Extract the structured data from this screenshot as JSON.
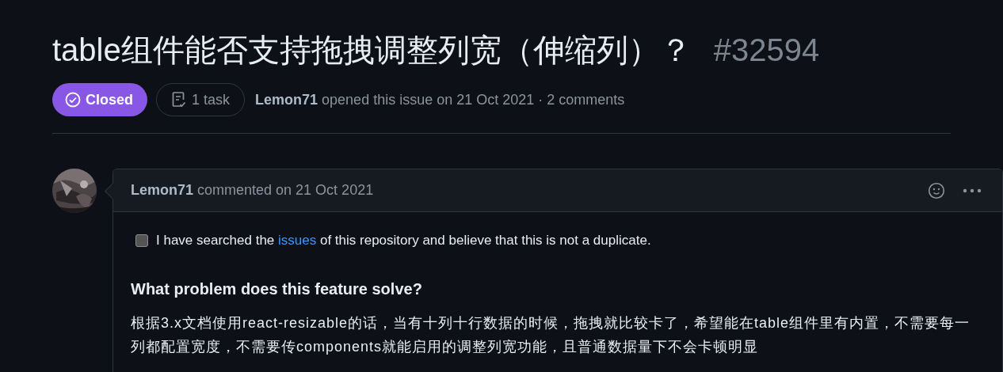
{
  "issue": {
    "title": "table组件能否支持拖拽调整列宽（伸缩列）？",
    "number": "#32594",
    "closed": true,
    "state_label": "Closed",
    "tasks": "1 task",
    "author": "Lemon71",
    "meta": "opened this issue on 21 Oct 2021 · 2 comments"
  },
  "comment": {
    "author": "Lemon71",
    "meta": "commented on 21 Oct 2021",
    "checklist": [
      {
        "before": "I have searched the ",
        "link": "issues",
        "after": " of this repository and believe that this is not a duplicate.",
        "checked": false
      }
    ],
    "heading": "What problem does this feature solve?",
    "body": "根据3.x文档使用react-resizable的话，当有十列十行数据的时候，拖拽就比较卡了，希望能在table组件里有内置，不需要每一列都配置宽度，不需要传components就能启用的调整列宽功能，且普通数据量下不会卡顿明显"
  }
}
